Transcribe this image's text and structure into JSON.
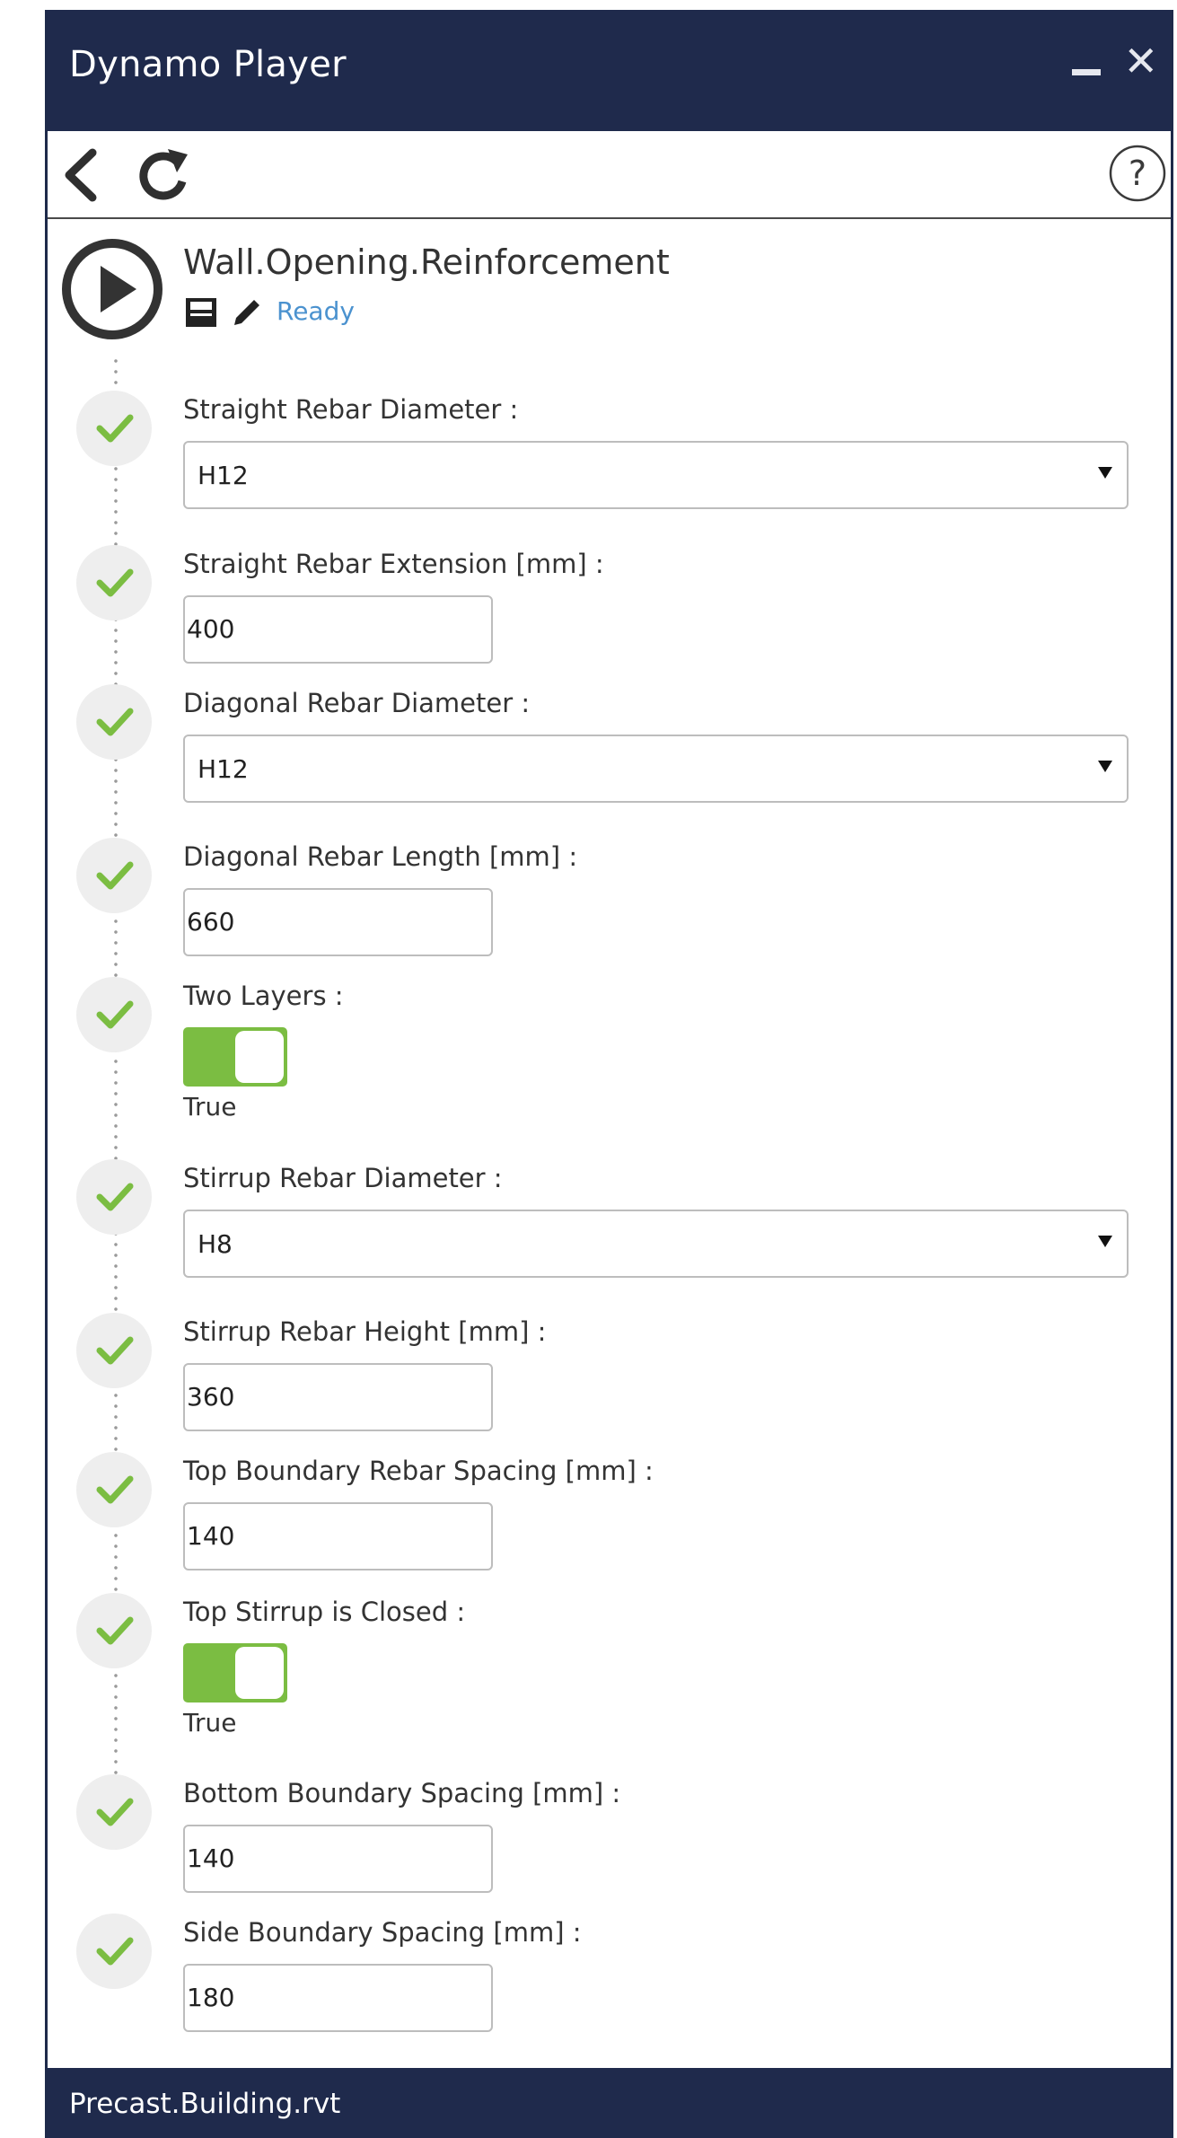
{
  "window": {
    "title": "Dynamo Player",
    "footer_file": "Precast.Building.rvt"
  },
  "toolbar": {
    "icons": [
      "back-icon",
      "refresh-icon",
      "help-icon"
    ]
  },
  "script": {
    "name": "Wall.Opening.Reinforcement",
    "status": "Ready",
    "icons": [
      "play-icon",
      "save-icon",
      "edit-icon"
    ]
  },
  "colors": {
    "titlebar": "#1f2a4c",
    "status": "#4b92cf",
    "check": "#7bbd42",
    "toggle_on": "#7bbd42"
  },
  "inputs": [
    {
      "label": "Straight Rebar Diameter :",
      "type": "dropdown",
      "value": "H12"
    },
    {
      "label": "Straight Rebar Extension [mm] :",
      "type": "text",
      "value": "400"
    },
    {
      "label": "Diagonal Rebar Diameter :",
      "type": "dropdown",
      "value": "H12"
    },
    {
      "label": "Diagonal Rebar Length [mm] :",
      "type": "text",
      "value": "660"
    },
    {
      "label": "Two Layers :",
      "type": "toggle",
      "value": "True",
      "checked": true
    },
    {
      "label": "Stirrup Rebar Diameter :",
      "type": "dropdown",
      "value": "H8"
    },
    {
      "label": "Stirrup Rebar Height [mm] :",
      "type": "text",
      "value": "360"
    },
    {
      "label": "Top Boundary Rebar Spacing [mm] :",
      "type": "text",
      "value": "140"
    },
    {
      "label": "Top Stirrup is Closed :",
      "type": "toggle",
      "value": "True",
      "checked": true
    },
    {
      "label": "Bottom Boundary Spacing [mm] :",
      "type": "text",
      "value": "140"
    },
    {
      "label": "Side Boundary Spacing [mm] :",
      "type": "text",
      "value": "180"
    }
  ]
}
